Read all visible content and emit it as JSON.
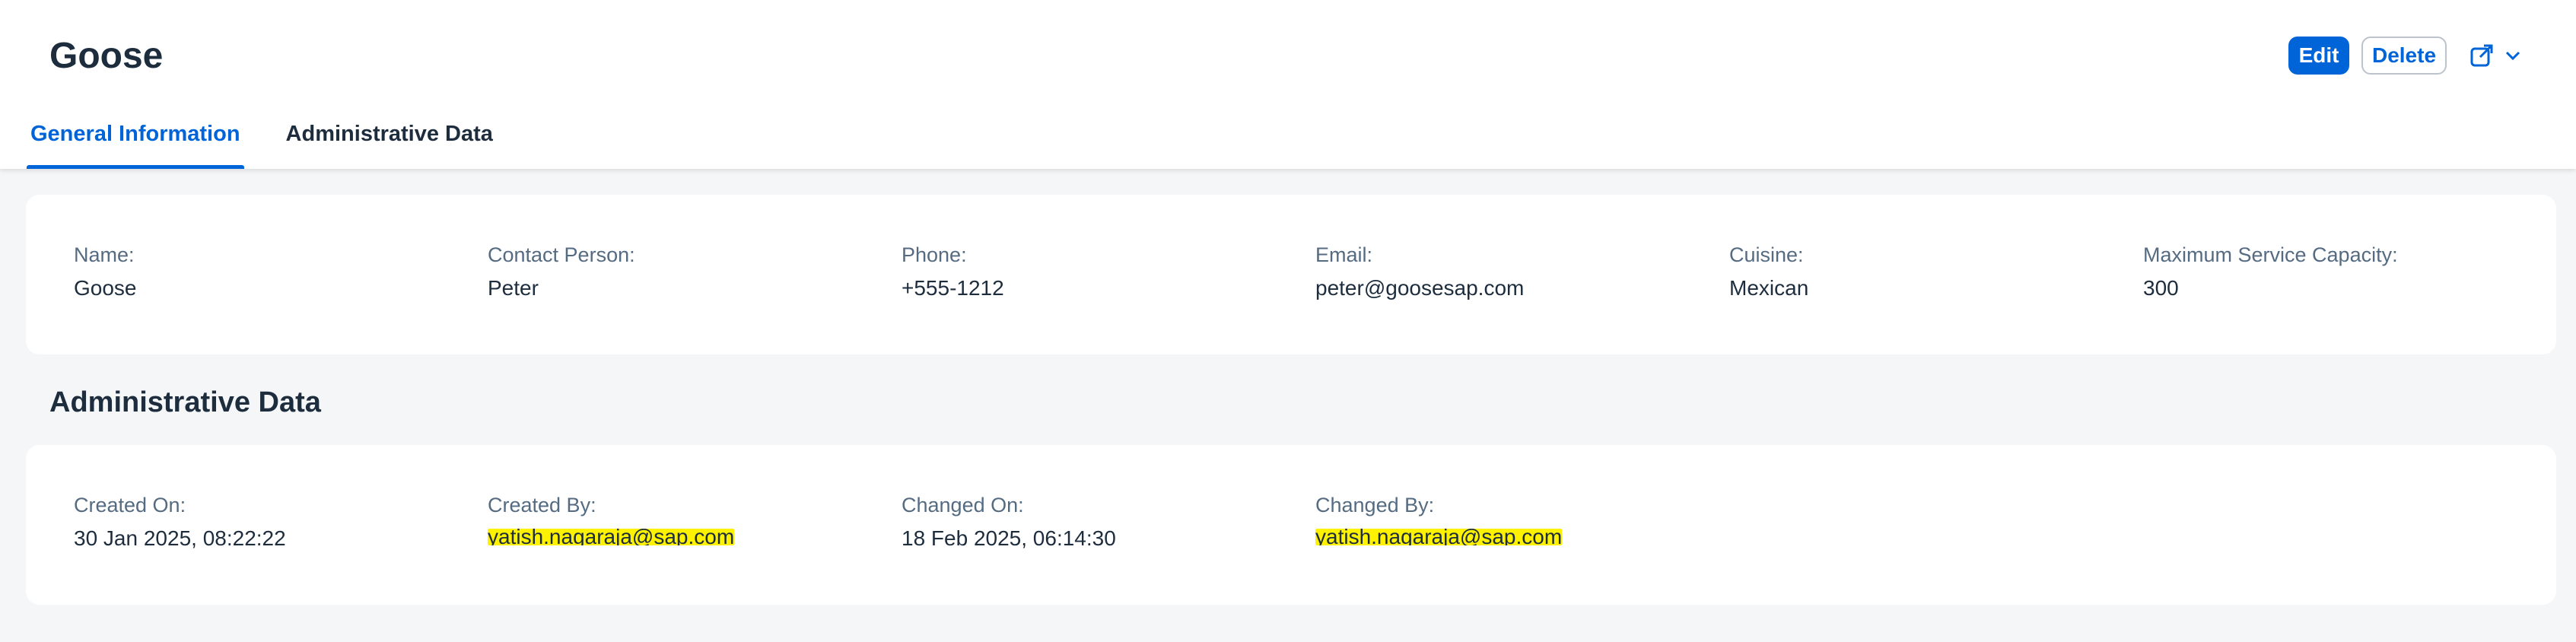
{
  "header": {
    "title": "Goose",
    "edit_label": "Edit",
    "delete_label": "Delete"
  },
  "tabs": [
    {
      "label": "General Information",
      "active": true
    },
    {
      "label": "Administrative Data",
      "active": false
    }
  ],
  "general": {
    "fields": [
      {
        "label": "Name:",
        "value": "Goose"
      },
      {
        "label": "Contact Person:",
        "value": "Peter"
      },
      {
        "label": "Phone:",
        "value": "+555-1212"
      },
      {
        "label": "Email:",
        "value": "peter@goosesap.com"
      },
      {
        "label": "Cuisine:",
        "value": "Mexican"
      },
      {
        "label": "Maximum Service Capacity:",
        "value": "300"
      }
    ]
  },
  "admin": {
    "title": "Administrative Data",
    "fields": [
      {
        "label": "Created On:",
        "value": "30 Jan 2025, 08:22:22"
      },
      {
        "label": "Created By:",
        "value": "yatish.nagaraja@sap.com"
      },
      {
        "label": "Changed On:",
        "value": "18 Feb 2025, 06:14:30"
      },
      {
        "label": "Changed By:",
        "value": "yatish.nagaraja@sap.com"
      }
    ]
  },
  "colors": {
    "accent": "#0064d9",
    "text": "#1d2d3e",
    "label": "#556b82",
    "background": "#f5f6f7",
    "highlight": "#fff200"
  },
  "icons": {
    "share": "share-icon",
    "chevron": "chevron-down-icon"
  }
}
